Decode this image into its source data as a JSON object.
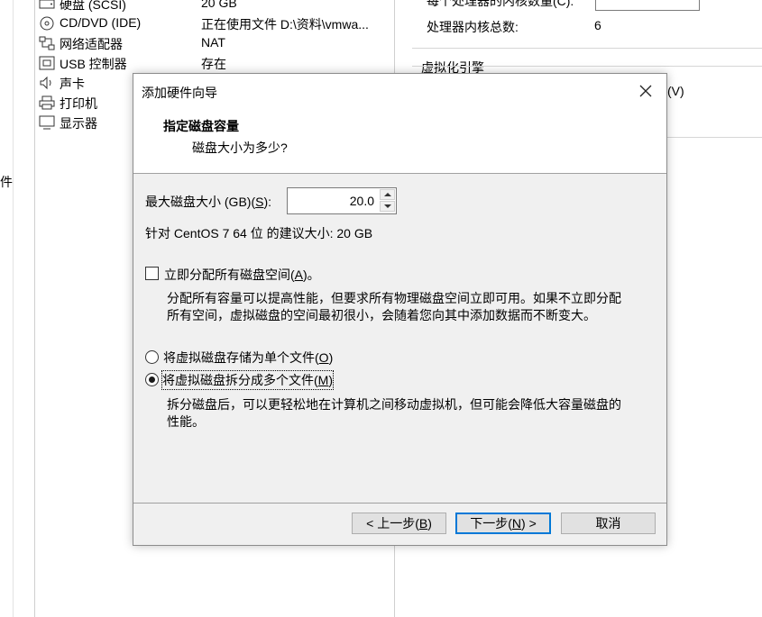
{
  "background": {
    "left_clip_text": "件",
    "devices": [
      {
        "icon": "hard-disk-icon",
        "name": "硬盘 (SCSI)",
        "summary": "20 GB"
      },
      {
        "icon": "cd-dvd-icon",
        "name": "CD/DVD (IDE)",
        "summary": "正在使用文件 D:\\资料\\vmwa..."
      },
      {
        "icon": "network-adapter-icon",
        "name": "网络适配器",
        "summary": "NAT"
      },
      {
        "icon": "usb-controller-icon",
        "name": "USB 控制器",
        "summary": "存在"
      },
      {
        "icon": "sound-card-icon",
        "name": "声卡",
        "summary": ""
      },
      {
        "icon": "printer-icon",
        "name": "打印机",
        "summary": ""
      },
      {
        "icon": "display-icon",
        "name": "显示器",
        "summary": ""
      }
    ],
    "right_pane": {
      "cores_per_processor_label": "每个处理器的内核数量(C):",
      "total_cores_label": "处理器内核总数:",
      "total_cores_value": "6",
      "virtualization_group": "虚拟化引擎",
      "partial_option_text": "(V)"
    }
  },
  "dialog": {
    "title": "添加硬件向导",
    "header_title": "指定磁盘容量",
    "header_subtitle": "磁盘大小为多少?",
    "max_size": {
      "label_pre": "最大磁盘大小 (GB)(",
      "label_key": "S",
      "label_post": "):",
      "value": "20.0"
    },
    "recommended": "针对 CentOS 7 64 位 的建议大小: 20 GB",
    "allocate_now": {
      "label_pre": "立即分配所有磁盘空间(",
      "label_key": "A",
      "label_post": ")。",
      "checked": false,
      "desc_line1": "分配所有容量可以提高性能，但要求所有物理磁盘空间立即可用。如果不立即分配",
      "desc_line2": "所有空间，虚拟磁盘的空间最初很小，会随着您向其中添加数据而不断变大。"
    },
    "single_file": {
      "label_pre": "将虚拟磁盘存储为单个文件(",
      "label_key": "O",
      "label_post": ")",
      "selected": false
    },
    "multi_file": {
      "label_pre": "将虚拟磁盘拆分成多个文件(",
      "label_key": "M",
      "label_post": ")",
      "selected": true,
      "desc_line1": "拆分磁盘后，可以更轻松地在计算机之间移动虚拟机，但可能会降低大容量磁盘的",
      "desc_line2": "性能。"
    },
    "buttons": {
      "back_pre": "< 上一步(",
      "back_key": "B",
      "back_post": ")",
      "next_pre": "下一步(",
      "next_key": "N",
      "next_post": ") >",
      "cancel": "取消"
    }
  }
}
